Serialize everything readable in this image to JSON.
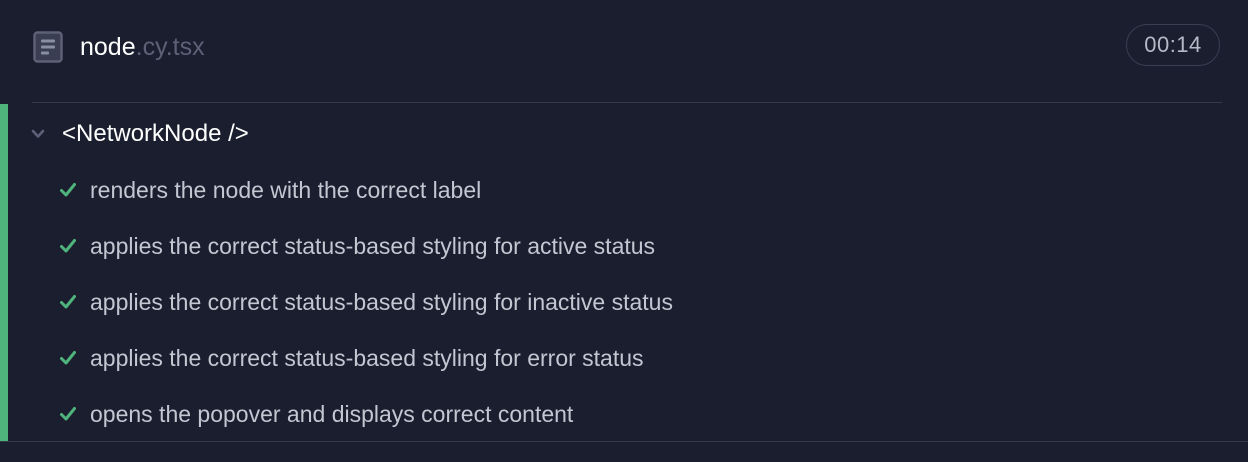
{
  "header": {
    "file_icon": "file-text-icon",
    "file_base": "node",
    "file_ext": ".cy.tsx",
    "duration": "00:14"
  },
  "suite": {
    "title": "<NetworkNode />",
    "status": "passed",
    "expanded": true,
    "status_color": "#4fb47b",
    "tests": [
      {
        "title": "renders the node with the correct label",
        "status": "passed"
      },
      {
        "title": "applies the correct status-based styling for active status",
        "status": "passed"
      },
      {
        "title": "applies the correct status-based styling for inactive status",
        "status": "passed"
      },
      {
        "title": "applies the correct status-based styling for error status",
        "status": "passed"
      },
      {
        "title": "opens the popover and displays correct content",
        "status": "passed"
      }
    ]
  },
  "colors": {
    "background": "#1b1e2e",
    "pass": "#4fb47b",
    "text": "#c4c6d2",
    "muted": "#5d6178"
  }
}
